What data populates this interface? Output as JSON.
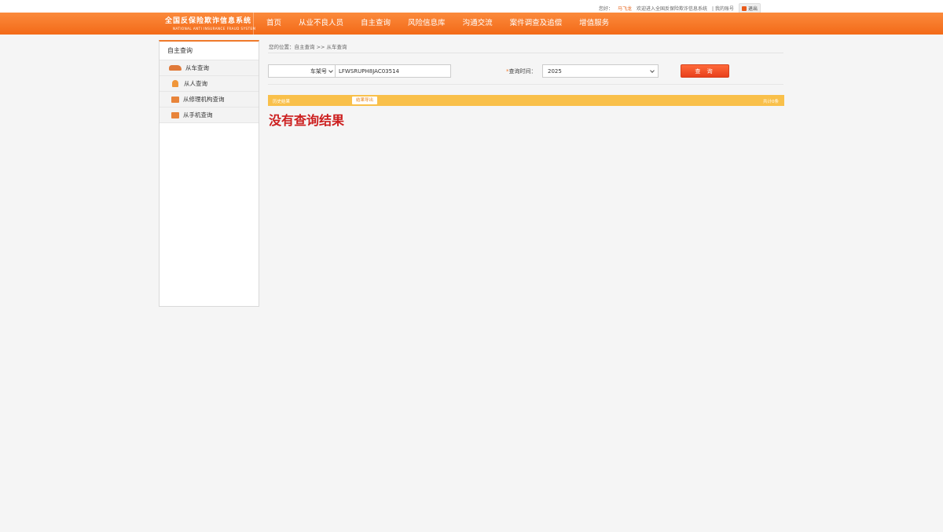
{
  "topbar": {
    "greeting": "您好：",
    "username": "马飞龙",
    "welcome": "欢迎进入全国反保险欺诈信息系统",
    "my_account": "| 我的账号",
    "logout": "退出"
  },
  "logo": {
    "title_cn": "全国反保险欺诈信息系统",
    "title_en": "NATIONAL ANTI INSURANCE FRAUD SYSTEM"
  },
  "nav": {
    "items": [
      "首页",
      "从业不良人员",
      "自主查询",
      "风险信息库",
      "沟通交流",
      "案件调查及追偿",
      "增值服务"
    ]
  },
  "sidebar": {
    "title": "自主查询",
    "items": [
      {
        "label": "从车查询",
        "icon": "car-icon"
      },
      {
        "label": "从人查询",
        "icon": "person-icon"
      },
      {
        "label": "从修理机构查询",
        "icon": "repair-shop-icon"
      },
      {
        "label": "从手机查询",
        "icon": "phone-icon"
      }
    ]
  },
  "breadcrumb": "您的位置：自主查询 >> 从车查询",
  "search": {
    "field_type": "车架号",
    "vin_value": "LFWSRUPH8JAC03514",
    "time_label": "查询时间：",
    "time_star": "*",
    "year_value": "2025",
    "query_button": "查 询"
  },
  "results": {
    "left_label": "历史结果",
    "tag": "结果导出",
    "count": "共计0条",
    "empty_message": "没有查询结果"
  },
  "colors": {
    "brand_orange": "#f36a18",
    "result_bar": "#f9c04a",
    "error_red": "#cc1f1f"
  }
}
